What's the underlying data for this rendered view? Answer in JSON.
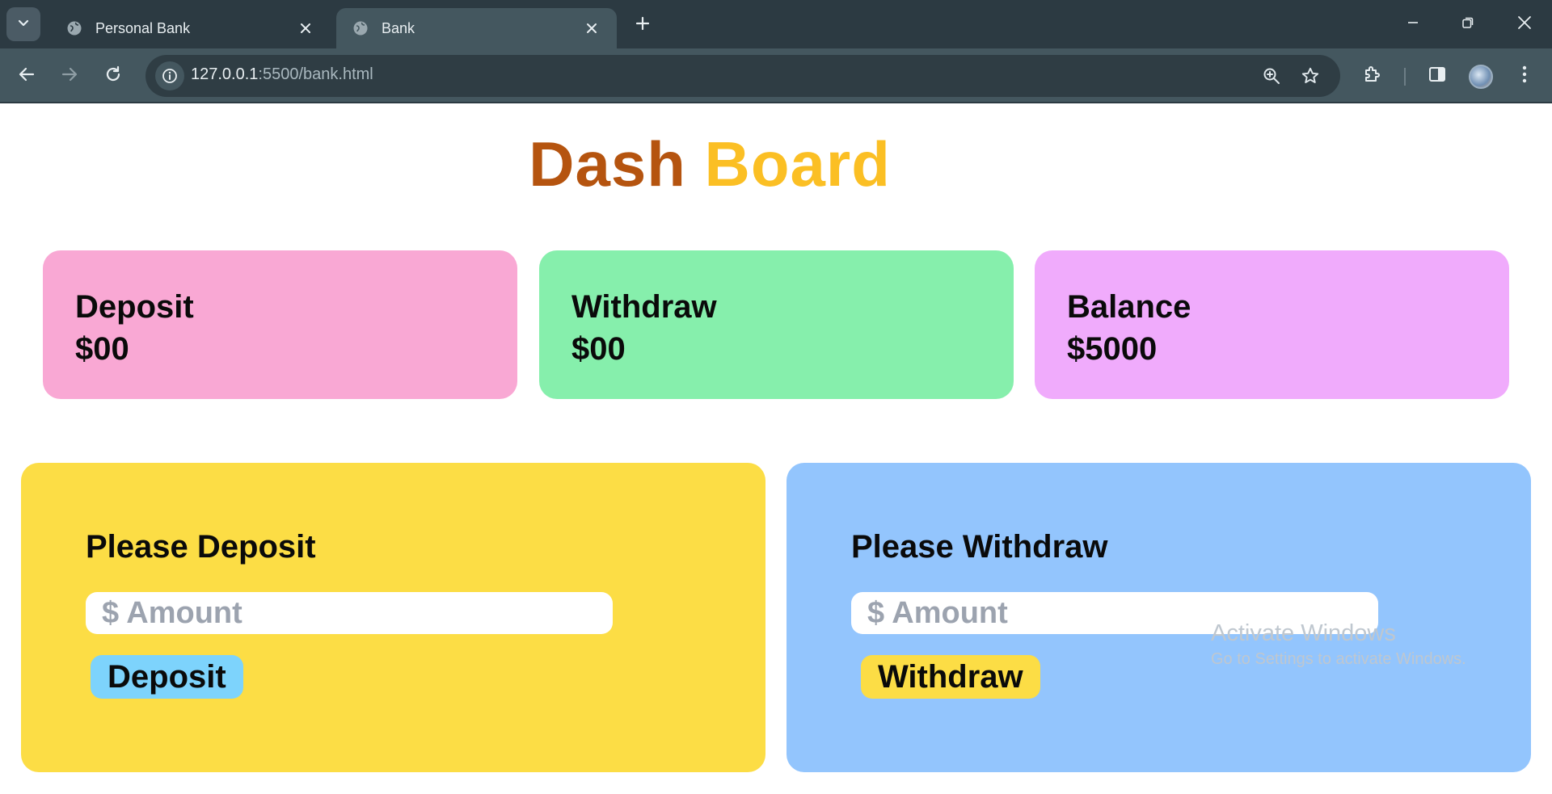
{
  "browser": {
    "tabs": [
      {
        "title": "Personal Bank",
        "active": false
      },
      {
        "title": "Bank",
        "active": true
      }
    ],
    "url_host": "127.0.0.1",
    "url_rest": ":5500/bank.html"
  },
  "page": {
    "title_part1": "Dash",
    "title_part2": "Board",
    "stats": {
      "deposit": {
        "label": "Deposit",
        "value": "$00",
        "color": "#f9a8d4"
      },
      "withdraw": {
        "label": "Withdraw",
        "value": "$00",
        "color": "#86efac"
      },
      "balance": {
        "label": "Balance",
        "value": "$5000",
        "color": "#f0abfc"
      }
    },
    "deposit_panel": {
      "heading": "Please Deposit",
      "placeholder": "$ Amount",
      "button": "Deposit",
      "panel_color": "#fcdd45",
      "button_color": "#7dd3fc"
    },
    "withdraw_panel": {
      "heading": "Please Withdraw",
      "placeholder": "$ Amount",
      "button": "Withdraw",
      "panel_color": "#93c5fd",
      "button_color": "#fcdd45"
    }
  },
  "watermark": {
    "line1": "Activate Windows",
    "line2": "Go to Settings to activate Windows."
  }
}
